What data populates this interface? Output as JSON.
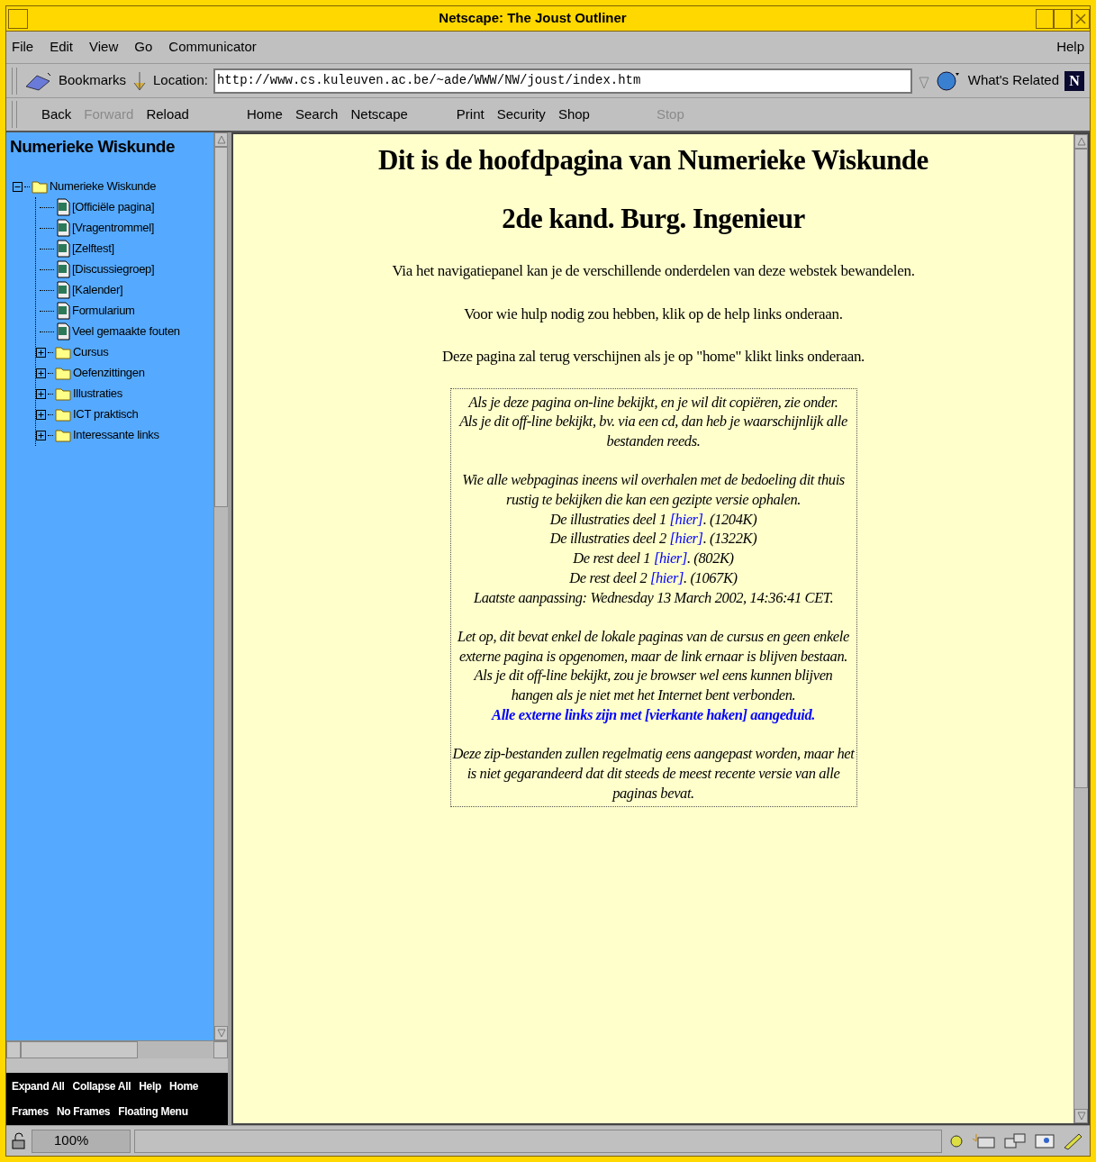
{
  "window": {
    "title": "Netscape: The Joust Outliner"
  },
  "menu": {
    "left": [
      "File",
      "Edit",
      "View",
      "Go",
      "Communicator"
    ],
    "right": "Help"
  },
  "location_bar": {
    "bookmarks": "Bookmarks",
    "location_label": "Location:",
    "url": "http://www.cs.kuleuven.ac.be/~ade/WWW/NW/joust/index.htm",
    "whats_related": "What's Related",
    "logo": "N"
  },
  "nav_toolbar": [
    {
      "label": "Back",
      "disabled": false
    },
    {
      "label": "Forward",
      "disabled": true
    },
    {
      "label": "Reload",
      "disabled": false
    },
    {
      "label": "Home",
      "disabled": false
    },
    {
      "label": "Search",
      "disabled": false
    },
    {
      "label": "Netscape",
      "disabled": false
    },
    {
      "label": "Print",
      "disabled": false
    },
    {
      "label": "Security",
      "disabled": false
    },
    {
      "label": "Shop",
      "disabled": false
    },
    {
      "label": "Stop",
      "disabled": true
    }
  ],
  "sidebar": {
    "title": "Numerieke Wiskunde",
    "tree": {
      "label": "Numerieke Wiskunde",
      "kind": "folder",
      "expanded": true,
      "children": [
        {
          "kind": "page",
          "label": "[Officiële pagina]"
        },
        {
          "kind": "page",
          "label": "[Vragentrommel]"
        },
        {
          "kind": "page",
          "label": "[Zelftest]"
        },
        {
          "kind": "page",
          "label": "[Discussiegroep]"
        },
        {
          "kind": "page",
          "label": "[Kalender]"
        },
        {
          "kind": "page",
          "label": "Formularium"
        },
        {
          "kind": "page",
          "label": "Veel gemaakte fouten"
        },
        {
          "kind": "folder",
          "label": "Cursus",
          "expanded": false
        },
        {
          "kind": "folder",
          "label": "Oefenzittingen",
          "expanded": false
        },
        {
          "kind": "folder",
          "label": "Illustraties",
          "expanded": false
        },
        {
          "kind": "folder",
          "label": "ICT praktisch",
          "expanded": false
        },
        {
          "kind": "folder",
          "label": "Interessante links",
          "expanded": false
        }
      ]
    },
    "menu_rows": [
      [
        "Expand All",
        "Collapse All",
        "Help",
        "Home"
      ],
      [
        "Frames",
        "No Frames",
        "Floating Menu"
      ]
    ]
  },
  "content": {
    "headings": [
      "Dit is de hoofdpagina van Numerieke Wiskunde",
      "2de kand. Burg. Ingenieur"
    ],
    "intro": [
      "Via het navigatiepanel kan je de verschillende onderdelen van deze webstek bewandelen.",
      "Voor wie hulp nodig zou hebben, klik op de help links onderaan.",
      "Deze pagina zal terug verschijnen als je op \"home\" klikt links onderaan."
    ],
    "box": [
      {
        "kind": "text",
        "text": "Als je deze pagina on-line bekijkt, en je wil dit copiëren, zie onder."
      },
      {
        "kind": "text",
        "text": "Als je dit off-line bekijkt, bv. via een cd, dan heb je waarschijnlijk alle bestanden reeds."
      },
      {
        "kind": "gap"
      },
      {
        "kind": "text",
        "text": "Wie alle webpaginas ineens wil overhalen met de bedoeling dit thuis rustig te bekijken die kan een gezipte versie ophalen."
      },
      {
        "kind": "download",
        "before": "De illustraties deel 1",
        "link": "[hier]",
        "after": ". (1204K)"
      },
      {
        "kind": "download",
        "before": "De illustraties deel 2",
        "link": "[hier]",
        "after": ". (1322K)"
      },
      {
        "kind": "download",
        "before": "De rest deel 1",
        "link": "[hier]",
        "after": ". (802K)"
      },
      {
        "kind": "download",
        "before": "De rest deel 2",
        "link": "[hier]",
        "after": ". (1067K)"
      },
      {
        "kind": "text",
        "text": "Laatste aanpassing: Wednesday 13 March 2002, 14:36:41 CET."
      },
      {
        "kind": "gap"
      },
      {
        "kind": "text",
        "text": "Let op, dit bevat enkel de lokale paginas van de cursus en geen enkele externe pagina is opgenomen, maar de link ernaar is blijven bestaan. Als je dit off-line bekijkt, zou je browser wel eens kunnen blijven hangen als je niet met het Internet bent verbonden."
      },
      {
        "kind": "emphasis",
        "text": "Alle externe links zijn met [vierkante haken] aangeduid."
      },
      {
        "kind": "gap"
      },
      {
        "kind": "text",
        "text": "Deze zip-bestanden zullen regelmatig eens aangepast worden, maar het is niet gegarandeerd dat dit steeds de meest recente versie van alle paginas bevat."
      }
    ]
  },
  "status_bar": {
    "zoom": "100%"
  }
}
